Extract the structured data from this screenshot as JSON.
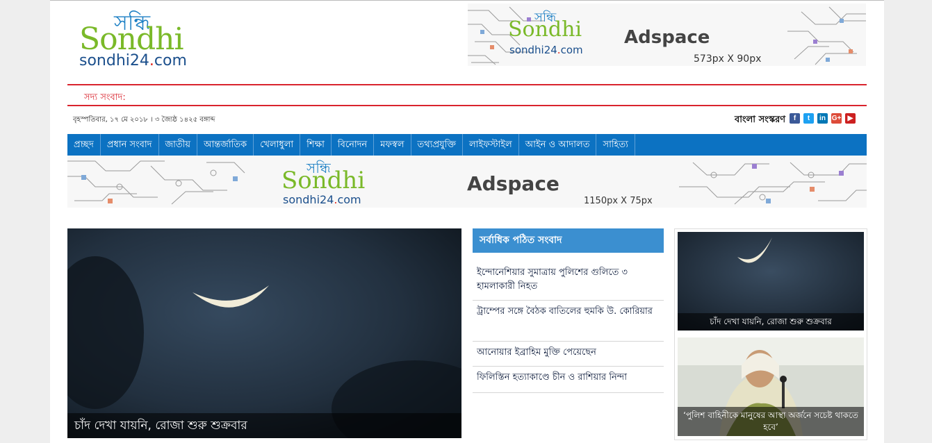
{
  "logo": {
    "bangla": "সন্ধি",
    "english": "Sondhi",
    "domain_name": "sondhi24",
    "domain_dot": ".",
    "domain_tld": "com"
  },
  "ads": {
    "top": {
      "logo_bangla": "সন্ধি",
      "logo_english": "Sondhi",
      "logo_domain_name": "sondhi24",
      "logo_domain_tld": "com",
      "title": "Adspace",
      "size": "573px X 90px"
    },
    "mid": {
      "logo_bangla": "সন্ধি",
      "logo_english": "Sondhi",
      "logo_domain_name": "sondhi24",
      "logo_domain_tld": "com",
      "title": "Adspace",
      "size": "1150px X 75px"
    }
  },
  "breaking": {
    "label": "সদ্য সংবাদ:"
  },
  "date_line": "বৃহস্পতিবার, ১৭ মে ২০১৮ । ৩ জ্যৈষ্ঠ ১৪২৫ বঙ্গাব্দ",
  "edition_label": "বাংলা সংস্করণ",
  "socials": [
    {
      "name": "facebook",
      "glyph": "f",
      "color": "#3b5998"
    },
    {
      "name": "twitter",
      "glyph": "t",
      "color": "#1da1f2"
    },
    {
      "name": "linkedin",
      "glyph": "in",
      "color": "#0077b5"
    },
    {
      "name": "google-plus",
      "glyph": "G+",
      "color": "#dd4b39"
    },
    {
      "name": "youtube",
      "glyph": "▶",
      "color": "#cc2020"
    }
  ],
  "nav": [
    "প্রচ্ছদ",
    "প্রধান সংবাদ",
    "জাতীয়",
    "আন্তর্জাতিক",
    "খেলাধুলা",
    "শিক্ষা",
    "বিনোদন",
    "মফস্বল",
    "তথ্যপ্রযুক্তি",
    "লাইফস্টাইল",
    "আইন ও আদালত",
    "সাহিত্য"
  ],
  "lead": {
    "caption": "চাঁদ দেখা যায়নি, রোজা শুরু শুক্রবার"
  },
  "most_read": {
    "title": "সর্বাধিক পঠিত সংবাদ",
    "items": [
      "ইন্দোনেশিয়ার সুমাত্রায় পুলিশের গুলিতে ৩ হামলাকারী নিহত",
      "ট্রাম্পের সঙ্গে বৈঠক বাতিলের হুমকি উ. কোরিয়ার",
      "আনোয়ার ইব্রাহিম মুক্তি পেয়েছেন",
      "ফিলিস্তিন হত্যাকাণ্ডে চীন ও রাশিয়ার নিন্দা"
    ]
  },
  "side": [
    {
      "caption": "চাঁদ দেখা যায়নি, রোজা শুরু শুক্রবার"
    },
    {
      "caption": "‘পুলিশ বাহিনীকে মানুষের আস্থা অর্জনে সচেষ্ট থাকতে হবে’"
    }
  ]
}
